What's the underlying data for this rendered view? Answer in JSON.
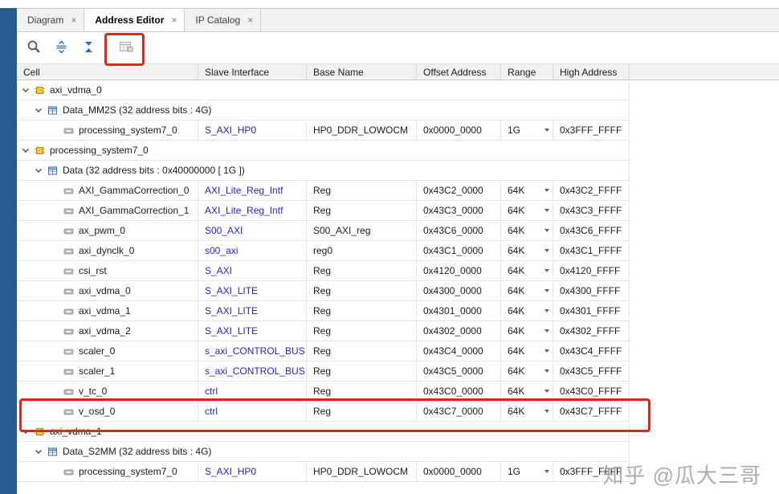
{
  "tabs": [
    {
      "label": "Diagram",
      "close": "×",
      "active": false
    },
    {
      "label": "Address Editor",
      "close": "×",
      "active": true
    },
    {
      "label": "IP Catalog",
      "close": "×",
      "active": false
    }
  ],
  "toolbar": {
    "icons": [
      {
        "name": "search-icon",
        "disabled": false
      },
      {
        "name": "expand-all-icon",
        "disabled": false
      },
      {
        "name": "collapse-all-icon",
        "disabled": false
      },
      {
        "name": "assign-address-icon",
        "disabled": true
      }
    ]
  },
  "table": {
    "columns": [
      "Cell",
      "Slave Interface",
      "Base Name",
      "Offset Address",
      "Range",
      "High Address"
    ],
    "rows": [
      {
        "kind": "cell-group",
        "label": "axi_vdma_0"
      },
      {
        "kind": "addr-group",
        "label": "Data_MM2S (32 address bits : 4G)"
      },
      {
        "kind": "leaf",
        "cell": "processing_system7_0",
        "slave": "S_AXI_HP0",
        "base": "HP0_DDR_LOWOCM",
        "offset": "0x0000_0000",
        "range": "1G",
        "high": "0x3FFF_FFFF"
      },
      {
        "kind": "cell-group",
        "label": "processing_system7_0"
      },
      {
        "kind": "addr-group",
        "label": "Data (32 address bits : 0x40000000 [ 1G ])"
      },
      {
        "kind": "leaf",
        "cell": "AXI_GammaCorrection_0",
        "slave": "AXI_Lite_Reg_Intf",
        "base": "Reg",
        "offset": "0x43C2_0000",
        "range": "64K",
        "high": "0x43C2_FFFF"
      },
      {
        "kind": "leaf",
        "cell": "AXI_GammaCorrection_1",
        "slave": "AXI_Lite_Reg_Intf",
        "base": "Reg",
        "offset": "0x43C3_0000",
        "range": "64K",
        "high": "0x43C3_FFFF"
      },
      {
        "kind": "leaf",
        "cell": "ax_pwm_0",
        "slave": "S00_AXI",
        "base": "S00_AXI_reg",
        "offset": "0x43C6_0000",
        "range": "64K",
        "high": "0x43C6_FFFF"
      },
      {
        "kind": "leaf",
        "cell": "axi_dynclk_0",
        "slave": "s00_axi",
        "base": "reg0",
        "offset": "0x43C1_0000",
        "range": "64K",
        "high": "0x43C1_FFFF"
      },
      {
        "kind": "leaf",
        "cell": "csi_rst",
        "slave": "S_AXI",
        "base": "Reg",
        "offset": "0x4120_0000",
        "range": "64K",
        "high": "0x4120_FFFF"
      },
      {
        "kind": "leaf",
        "cell": "axi_vdma_0",
        "slave": "S_AXI_LITE",
        "base": "Reg",
        "offset": "0x4300_0000",
        "range": "64K",
        "high": "0x4300_FFFF"
      },
      {
        "kind": "leaf",
        "cell": "axi_vdma_1",
        "slave": "S_AXI_LITE",
        "base": "Reg",
        "offset": "0x4301_0000",
        "range": "64K",
        "high": "0x4301_FFFF"
      },
      {
        "kind": "leaf",
        "cell": "axi_vdma_2",
        "slave": "S_AXI_LITE",
        "base": "Reg",
        "offset": "0x4302_0000",
        "range": "64K",
        "high": "0x4302_FFFF"
      },
      {
        "kind": "leaf",
        "cell": "scaler_0",
        "slave": "s_axi_CONTROL_BUS",
        "base": "Reg",
        "offset": "0x43C4_0000",
        "range": "64K",
        "high": "0x43C4_FFFF"
      },
      {
        "kind": "leaf",
        "cell": "scaler_1",
        "slave": "s_axi_CONTROL_BUS",
        "base": "Reg",
        "offset": "0x43C5_0000",
        "range": "64K",
        "high": "0x43C5_FFFF"
      },
      {
        "kind": "leaf",
        "cell": "v_tc_0",
        "slave": "ctrl",
        "base": "Reg",
        "offset": "0x43C0_0000",
        "range": "64K",
        "high": "0x43C0_FFFF"
      },
      {
        "kind": "leaf",
        "cell": "v_osd_0",
        "slave": "ctrl",
        "base": "Reg",
        "offset": "0x43C7_0000",
        "range": "64K",
        "high": "0x43C7_FFFF",
        "highlighted": true
      },
      {
        "kind": "cell-group",
        "label": "axi_vdma_1"
      },
      {
        "kind": "addr-group",
        "label": "Data_S2MM (32 address bits : 4G)"
      },
      {
        "kind": "leaf",
        "cell": "processing_system7_0",
        "slave": "S_AXI_HP0",
        "base": "HP0_DDR_LOWOCM",
        "offset": "0x0000_0000",
        "range": "1G",
        "high": "0x3FFF_FFFF"
      }
    ]
  },
  "annotations": {
    "highlight_color": "#e0261c",
    "targets": [
      "toolbar-assign-address-icon",
      "v_osd_0-row"
    ]
  },
  "watermark": {
    "text": "知乎 @瓜大三哥"
  }
}
